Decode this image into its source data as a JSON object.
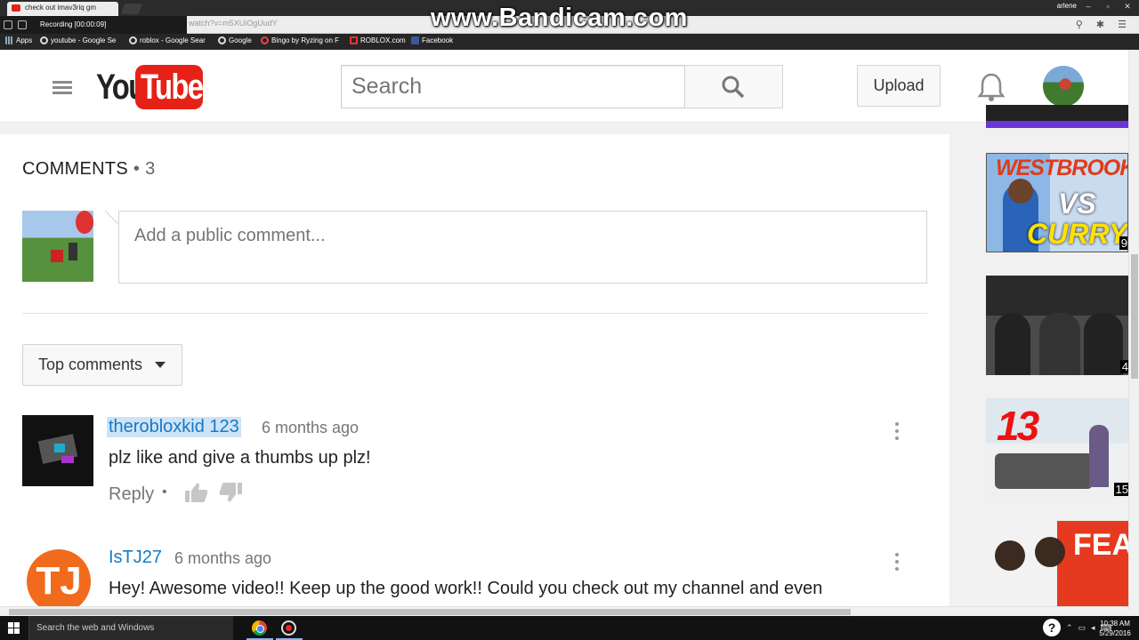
{
  "browser": {
    "active_tab_title": "check out imav3riq gm",
    "url_fragment": "watch?v=m5XUiOgUudY",
    "profile_name": "arlene",
    "bookmarks": [
      "Apps",
      "youtube - Google Se",
      "roblox - Google Sear",
      "Google",
      "Bingo by Ryzing on F",
      "ROBLOX.com",
      "Facebook"
    ]
  },
  "recorder": {
    "status": "Recording [00:00:09]",
    "watermark": "www.Bandicam.com"
  },
  "youtube": {
    "logo_you": "You",
    "logo_tube": "Tube",
    "search_placeholder": "Search",
    "upload_label": "Upload",
    "brand_color": "#e62117",
    "link_color": "#167ac6"
  },
  "comments": {
    "heading": "COMMENTS",
    "count": "• 3",
    "compose_placeholder": "Add a public comment...",
    "sort_label": "Top comments",
    "items": [
      {
        "author": "therobloxkid 123",
        "time": "6 months ago",
        "text": "plz like and give a thumbs up plz!",
        "reply_label": "Reply",
        "dot": "•"
      },
      {
        "author": "IsTJ27",
        "avatar_letters": "TJ",
        "time": "6 months ago",
        "text": "Hey! Awesome video!! Keep up the good work!! Could you check out my channel and even",
        "avatar_color": "#f06b1c"
      }
    ]
  },
  "sidebar": {
    "thumbs": [
      {
        "title_top": "WESTBROOK",
        "vs": "VS",
        "title_bottom": "CURRY",
        "badge": "9"
      },
      {
        "badge": "4"
      },
      {
        "number": "13",
        "badge": "15"
      },
      {
        "text": "FEA",
        "badge": ""
      }
    ]
  },
  "taskbar": {
    "search_placeholder": "Search the web and Windows",
    "help": "?",
    "time": "10:38 AM",
    "date": "5/29/2016"
  }
}
